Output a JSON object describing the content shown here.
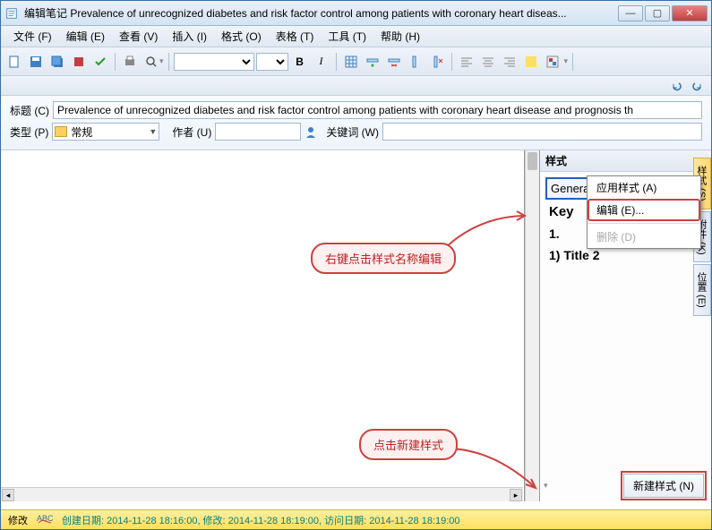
{
  "window": {
    "title": "编辑笔记 Prevalence of unrecognized diabetes and risk factor control among patients with coronary heart diseas..."
  },
  "menubar": {
    "file": "文件 (F)",
    "edit": "编辑 (E)",
    "view": "查看 (V)",
    "insert": "插入 (I)",
    "format": "格式 (O)",
    "table": "表格 (T)",
    "tools": "工具 (T)",
    "help": "帮助 (H)"
  },
  "toolbar": {
    "bold": "B",
    "italic": "I"
  },
  "fields": {
    "title_label": "标题 (C)",
    "title_value": "Prevalence of unrecognized diabetes and risk factor control among patients with coronary heart disease and prognosis th",
    "type_label": "类型 (P)",
    "type_value": "常规",
    "author_label": "作者 (U)",
    "keyword_label": "关键词 (W)"
  },
  "sidepanel": {
    "title": "样式",
    "styles": {
      "general": "General",
      "keywords": "Key",
      "title1": "1.",
      "title2": "1)  Title 2"
    },
    "context": {
      "apply": "应用样式 (A)",
      "edit": "编辑 (E)...",
      "delete": "删除 (D)"
    },
    "new_style": "新建样式 (N)"
  },
  "tabs": {
    "style": "样式 (S)",
    "attach": "附件 (K)",
    "pos": "位置 (E)"
  },
  "callouts": {
    "c1": "右键点击样式名称编辑",
    "c2": "点击新建样式"
  },
  "statusbar": {
    "mod": "修改",
    "dates": "创建日期: 2014-11-28 18:16:00, 修改: 2014-11-28 18:19:00, 访问日期: 2014-11-28 18:19:00"
  }
}
